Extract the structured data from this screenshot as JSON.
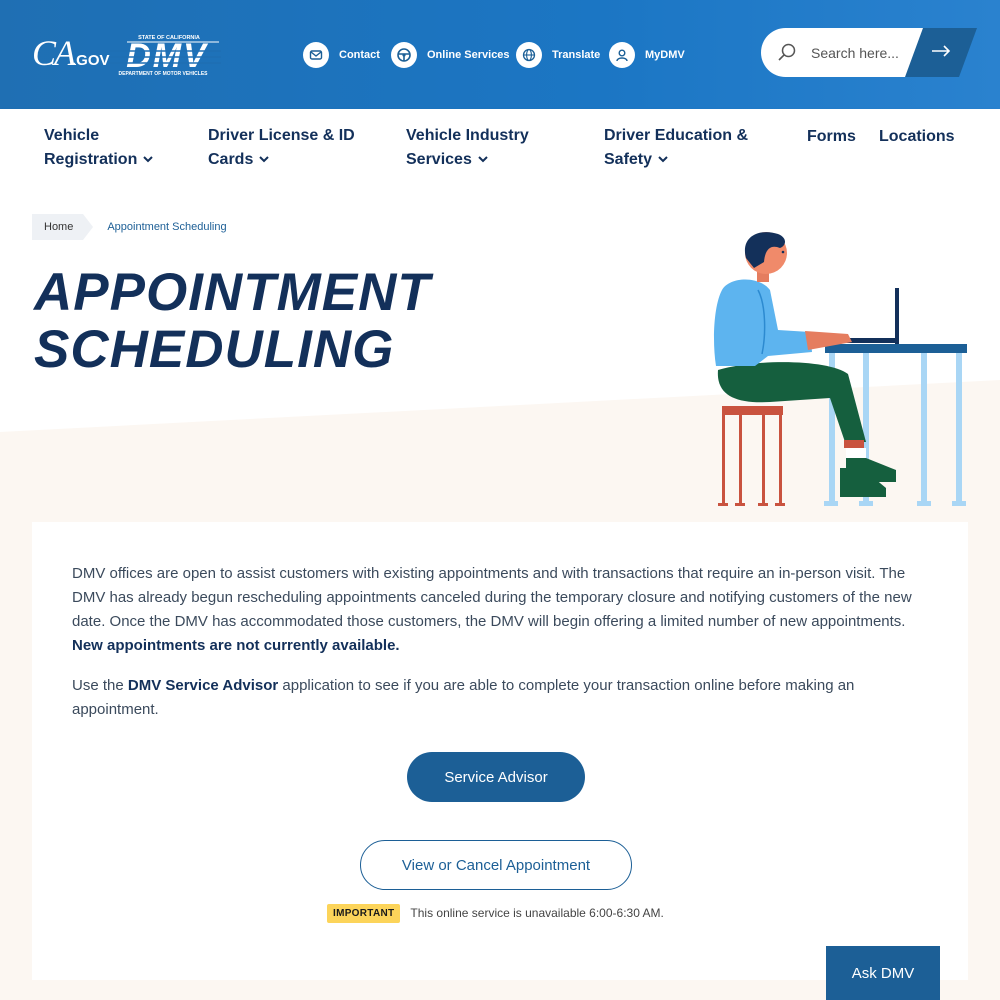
{
  "header": {
    "ca_logo": "CA",
    "ca_logo_suffix": ".GOV",
    "dmv_logo_top": "STATE OF CALIFORNIA",
    "dmv_logo_main": "DMV",
    "dmv_logo_bottom": "DEPARTMENT OF MOTOR VEHICLES",
    "links": [
      {
        "label": "Contact",
        "icon": "mail-icon"
      },
      {
        "label": "Online Services",
        "icon": "steering-wheel-icon"
      },
      {
        "label": "Translate",
        "icon": "globe-icon"
      },
      {
        "label": "MyDMV",
        "icon": "user-icon"
      }
    ],
    "search": {
      "placeholder": "Search here..."
    }
  },
  "nav": {
    "items": [
      {
        "line1": "Vehicle",
        "line2": "Registration",
        "dropdown": true
      },
      {
        "line1": "Driver License & ID",
        "line2": "Cards",
        "dropdown": true
      },
      {
        "line1": "Vehicle Industry",
        "line2": "Services",
        "dropdown": true
      },
      {
        "line1": "Driver Education &",
        "line2": "Safety",
        "dropdown": true
      },
      {
        "line1": "Forms",
        "dropdown": false
      },
      {
        "line1": "Locations",
        "dropdown": false
      }
    ]
  },
  "breadcrumb": {
    "home": "Home",
    "current": "Appointment Scheduling"
  },
  "page": {
    "title_line1": "APPOINTMENT",
    "title_line2": "SCHEDULING"
  },
  "content": {
    "para1_text": "DMV offices are open to assist customers with existing appointments and with transactions that require an in-person visit. The DMV has already begun rescheduling appointments canceled during the temporary closure and notifying customers of the new date. Once the DMV has accommodated those customers, the DMV will begin offering a limited number of new appointments. ",
    "para1_bold": "New appointments are not currently available.",
    "para2_pre": "Use the ",
    "para2_bold": "DMV Service Advisor",
    "para2_post": " application to see if you are able to complete your transaction online before making an appointment.",
    "service_advisor_button": "Service Advisor",
    "view_cancel_button": "View or Cancel Appointment",
    "important_badge": "IMPORTANT",
    "important_text": "This online service is unavailable 6:00-6:30 AM."
  },
  "ask_dmv": "Ask DMV",
  "colors": {
    "header_blue": "#1b76c4",
    "navy": "#13305a",
    "button_blue": "#1c5f96",
    "badge_yellow": "#fcd45a",
    "cream": "#fcf7f2"
  }
}
